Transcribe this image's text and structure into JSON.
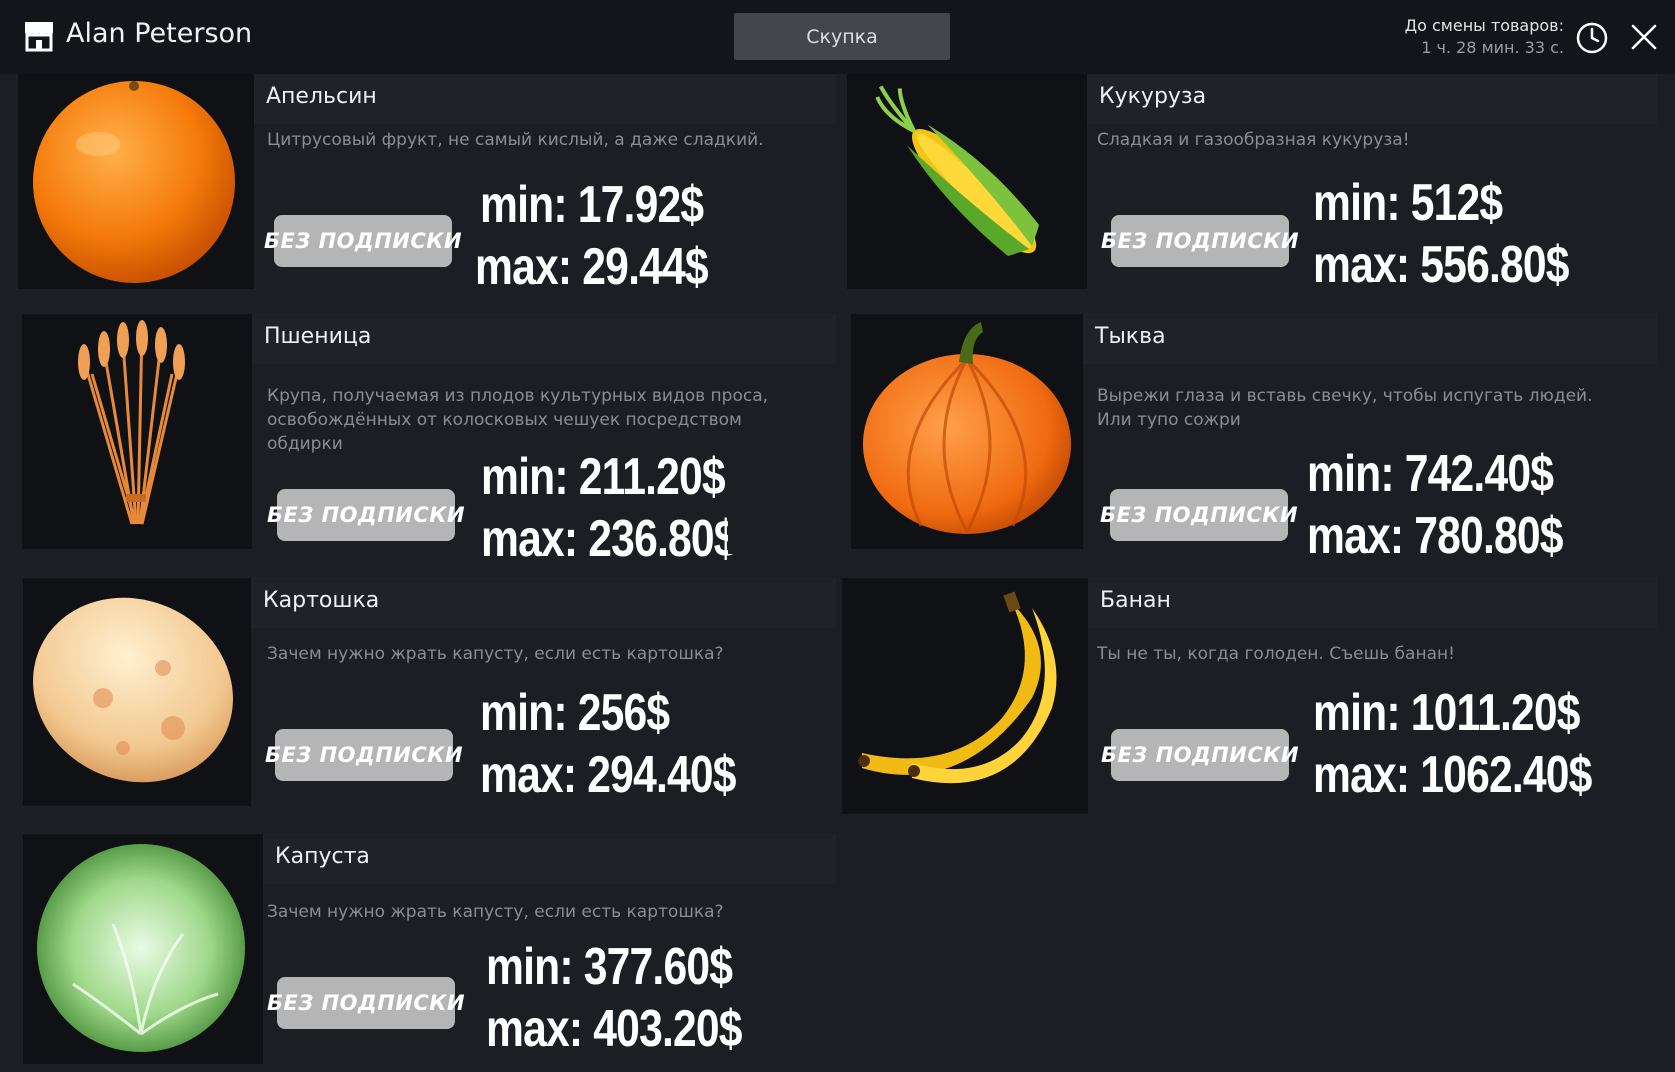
{
  "header": {
    "player_name": "Alan Peterson",
    "tab_label": "Скупка",
    "timer_label": "До смены товаров:",
    "timer_value": "1 ч. 28 мин. 33 с."
  },
  "items": [
    {
      "name": "Апельсин",
      "description": "Цитрусовый фрукт, не самый кислый, а даже сладкий.",
      "badge": "БЕЗ ПОДПИСКИ",
      "min": "min: 17.92$",
      "max": "max: 29.44$",
      "icon": "orange-icon"
    },
    {
      "name": "Кукуруза",
      "description": "Сладкая и газообразная кукуруза!",
      "badge": "БЕЗ ПОДПИСКИ",
      "min": "min: 512$",
      "max": "max: 556.80$",
      "icon": "corn-icon"
    },
    {
      "name": "Пшеница",
      "description": "Крупа, получаемая из плодов культурных видов проса, освобождённых от колосковых чешуек посредством обдирки",
      "badge": "БЕЗ ПОДПИСКИ",
      "min": "min: 211.20$",
      "max": "max: 236.80$",
      "icon": "wheat-icon"
    },
    {
      "name": "Тыква",
      "description": "Вырежи глаза и вставь свечку, чтобы испугать людей. Или тупо сожри",
      "badge": "БЕЗ ПОДПИСКИ",
      "min": "min: 742.40$",
      "max": "max: 780.80$",
      "icon": "pumpkin-icon"
    },
    {
      "name": "Картошка",
      "description": "Зачем нужно жрать капусту, если есть картошка?",
      "badge": "БЕЗ ПОДПИСКИ",
      "min": "min: 256$",
      "max": "max: 294.40$",
      "icon": "potato-icon"
    },
    {
      "name": "Банан",
      "description": "Ты не ты, когда голоден. Съешь банан!",
      "badge": "БЕЗ ПОДПИСКИ",
      "min": "min: 1011.20$",
      "max": "max: 1062.40$",
      "icon": "banana-icon"
    },
    {
      "name": "Капуста",
      "description": "Зачем нужно жрать капусту, если есть картошка?",
      "badge": "БЕЗ ПОДПИСКИ",
      "min": "min: 377.60$",
      "max": "max: 403.20$",
      "icon": "cabbage-icon"
    }
  ],
  "colors": {
    "background": "#1b1f24",
    "header": "#12151a",
    "badge": "#b5b5b5",
    "tab": "#43464c"
  }
}
